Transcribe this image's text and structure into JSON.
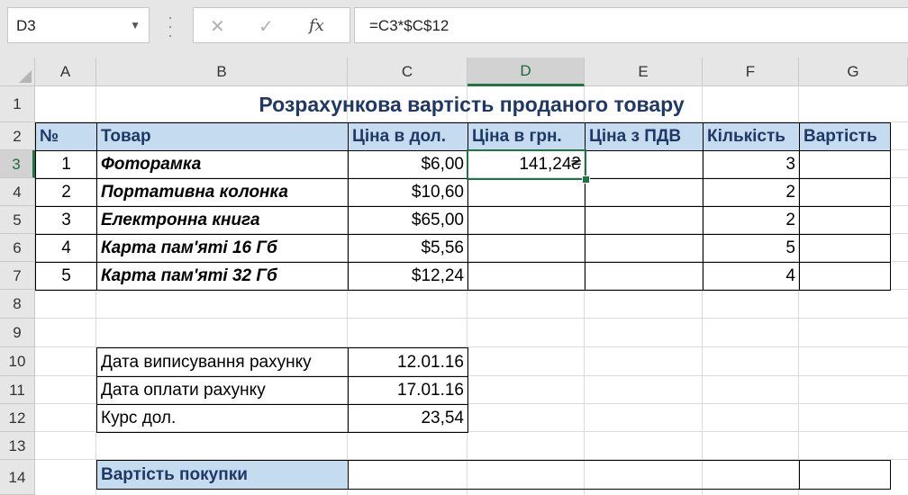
{
  "namebox": {
    "value": "D3"
  },
  "formula_bar": {
    "fx_label": "fx",
    "formula": "=C3*$C$12"
  },
  "columns": [
    "A",
    "B",
    "C",
    "D",
    "E",
    "F",
    "G"
  ],
  "rows": [
    "1",
    "2",
    "3",
    "4",
    "5",
    "6",
    "7",
    "8",
    "9",
    "10",
    "11",
    "12",
    "13",
    "14"
  ],
  "sheet": {
    "title": "Розрахункова вартість проданого товару",
    "headers": [
      "№",
      "Товар",
      "Ціна в дол.",
      "Ціна в грн.",
      "Ціна з ПДВ",
      "Кількість",
      "Вартість"
    ],
    "items": [
      {
        "num": "1",
        "name": "Фоторамка",
        "price_usd": "$6,00",
        "price_uah": "141,24₴",
        "qty": "3"
      },
      {
        "num": "2",
        "name": "Портативна колонка",
        "price_usd": "$10,60",
        "price_uah": "",
        "qty": "2"
      },
      {
        "num": "3",
        "name": "Електронна книга",
        "price_usd": "$65,00",
        "price_uah": "",
        "qty": "2"
      },
      {
        "num": "4",
        "name": "Карта пам'яті 16 Гб",
        "price_usd": "$5,56",
        "price_uah": "",
        "qty": "5"
      },
      {
        "num": "5",
        "name": "Карта пам'яті 32 Гб",
        "price_usd": "$12,24",
        "price_uah": "",
        "qty": "4"
      }
    ],
    "info": [
      {
        "label": "Дата виписування рахунку",
        "value": "12.01.16"
      },
      {
        "label": "Дата оплати рахунку",
        "value": "17.01.16"
      },
      {
        "label": "Курс дол.",
        "value": "23,54"
      }
    ],
    "total_label": "Вартість покупки"
  },
  "colors": {
    "header_fill": "#c5dcf0",
    "accent": "#217346",
    "title_text": "#1f3864"
  }
}
